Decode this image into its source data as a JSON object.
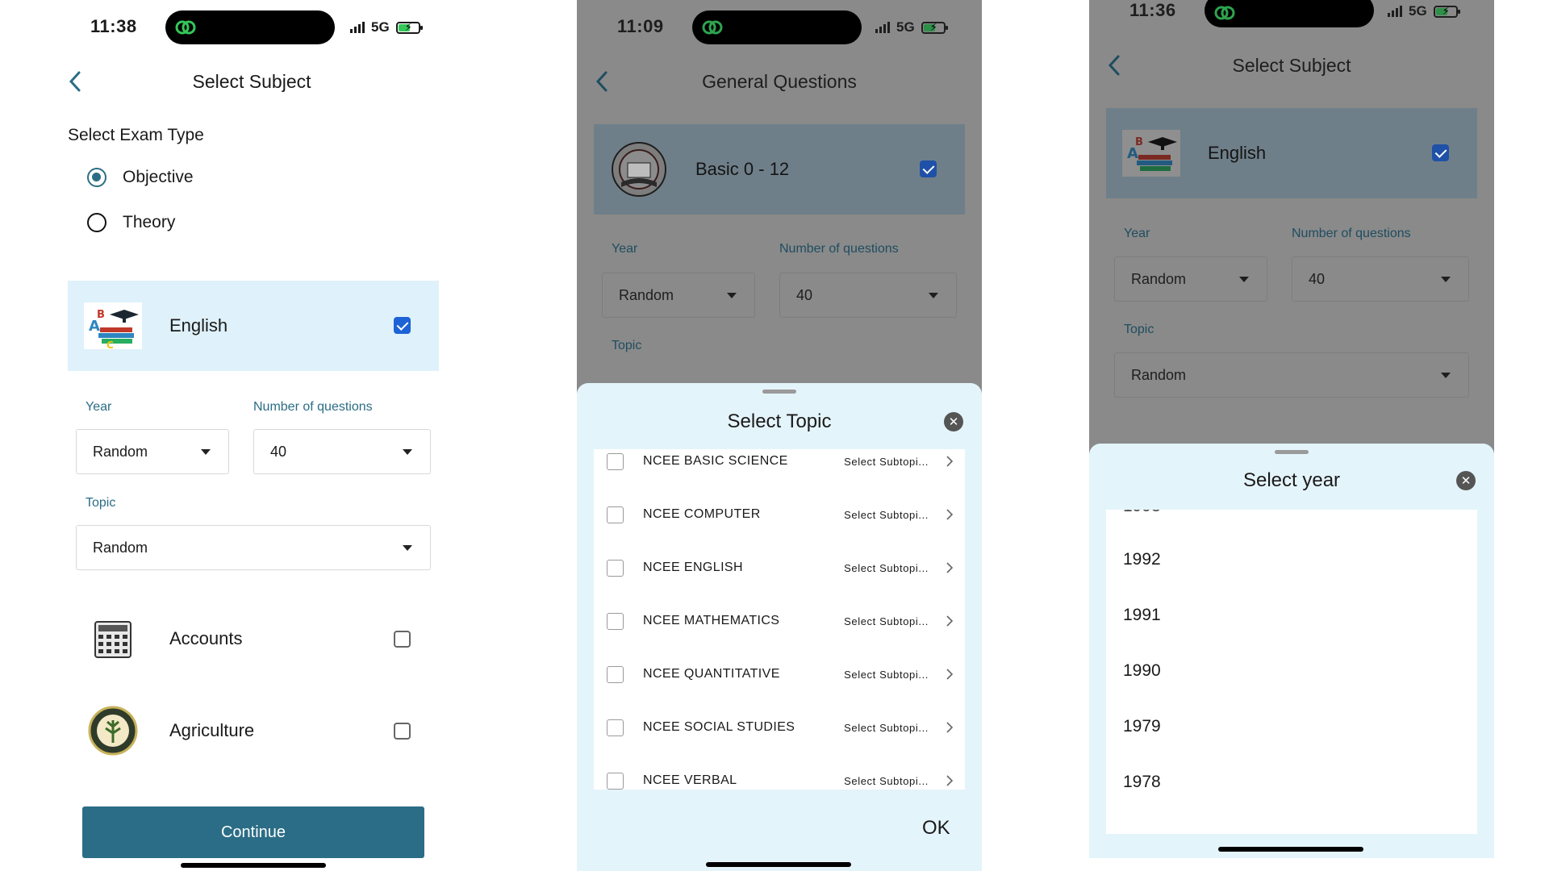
{
  "phone1": {
    "status": {
      "time": "11:38",
      "network": "5G"
    },
    "header": {
      "title": "Select Subject"
    },
    "exam_type": {
      "label": "Select Exam Type",
      "options": [
        {
          "label": "Objective",
          "selected": true
        },
        {
          "label": "Theory",
          "selected": false
        }
      ]
    },
    "subjects": [
      {
        "name": "English",
        "checked": true,
        "icon": "abc-books-icon"
      },
      {
        "name": "Accounts",
        "checked": false,
        "icon": "calculator-icon"
      },
      {
        "name": "Agriculture",
        "checked": false,
        "icon": "agriculture-seal-icon"
      }
    ],
    "fields": {
      "year_label": "Year",
      "year_value": "Random",
      "count_label": "Number of questions",
      "count_value": "40",
      "topic_label": "Topic",
      "topic_value": "Random"
    },
    "continue_label": "Continue"
  },
  "phone2": {
    "status": {
      "time": "11:09",
      "network": "5G"
    },
    "header": {
      "title": "General Questions"
    },
    "card": {
      "name": "Basic 0 - 12",
      "checked": true,
      "icon": "exam-book-icon"
    },
    "fields": {
      "year_label": "Year",
      "year_value": "Random",
      "count_label": "Number of questions",
      "count_value": "40",
      "topic_label": "Topic"
    },
    "sheet": {
      "title": "Select Topic",
      "subtopic_label": "Select Subtopi...",
      "topics": [
        "NCEE BASIC SCIENCE",
        "NCEE COMPUTER",
        "NCEE ENGLISH",
        "NCEE MATHEMATICS",
        "NCEE QUANTITATIVE",
        "NCEE SOCIAL STUDIES",
        "NCEE VERBAL"
      ],
      "ok_label": "OK"
    }
  },
  "phone3": {
    "status": {
      "time": "11:36",
      "network": "5G"
    },
    "header": {
      "title": "Select Subject"
    },
    "card": {
      "name": "English",
      "checked": true,
      "icon": "abc-books-icon"
    },
    "fields": {
      "year_label": "Year",
      "year_value": "Random",
      "count_label": "Number of questions",
      "count_value": "40",
      "topic_label": "Topic",
      "topic_value": "Random"
    },
    "sheet": {
      "title": "Select year",
      "years": [
        "1992",
        "1991",
        "1990",
        "1979",
        "1978"
      ]
    }
  },
  "colors": {
    "accent": "#2b6d86",
    "card_highlight": "#dff1fa",
    "checkbox_blue": "#1d63d6",
    "sheet_bg": "#e4f4fb",
    "dim_overlay": "#8a8a8a"
  }
}
